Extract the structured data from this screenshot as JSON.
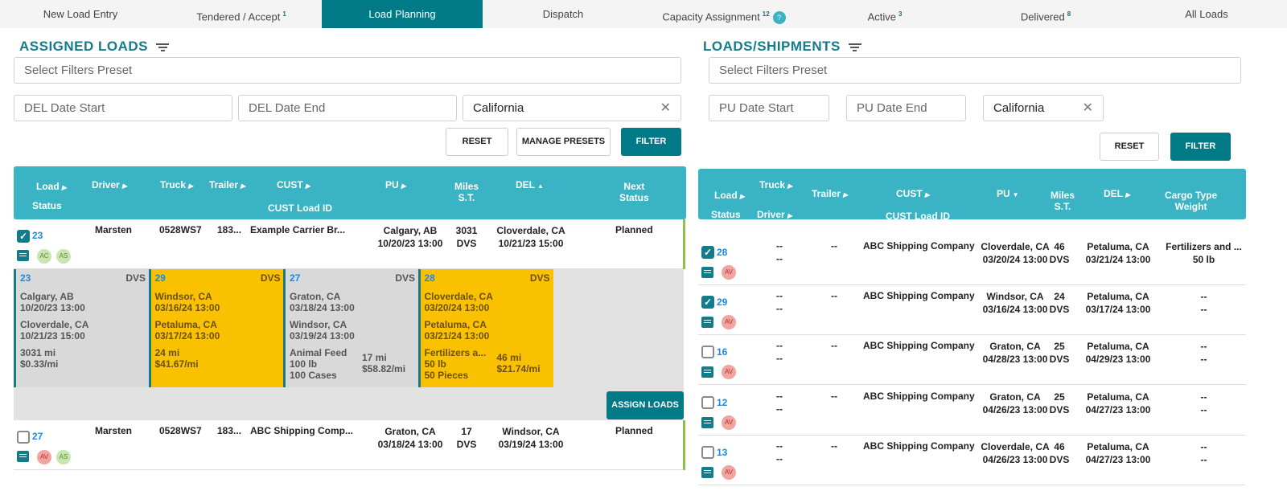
{
  "tabs": [
    {
      "label": "New Load Entry",
      "count": ""
    },
    {
      "label": "Tendered / Accept",
      "count": "1"
    },
    {
      "label": "Load Planning",
      "count": "",
      "active": true
    },
    {
      "label": "Dispatch",
      "count": ""
    },
    {
      "label": "Capacity Assignment",
      "count": "12",
      "help": "?"
    },
    {
      "label": "Active",
      "count": "3"
    },
    {
      "label": "Delivered",
      "count": "8"
    },
    {
      "label": "All Loads",
      "count": ""
    }
  ],
  "left": {
    "title": "ASSIGNED LOADS",
    "preset_placeholder": "Select Filters Preset",
    "date_start": "DEL Date Start",
    "date_end": "DEL Date End",
    "state": "California",
    "reset": "RESET",
    "manage": "MANAGE PRESETS",
    "filter": "FILTER",
    "assign": "ASSIGN LOADS",
    "headers": {
      "load": "Load",
      "status": "Status",
      "driver": "Driver",
      "truck": "Truck",
      "trailer": "Trailer",
      "cust": "CUST",
      "cust_id": "CUST Load ID",
      "pu": "PU",
      "miles": "Miles",
      "st": "S.T.",
      "del": "DEL",
      "next1": "Next",
      "next2": "Status"
    },
    "rows": [
      {
        "id": "23",
        "checked": true,
        "driver": "Marsten",
        "truck": "0528WS7",
        "trailer": "183...",
        "cust": "Example Carrier Br...",
        "pu_city": "Calgary, AB",
        "pu_date": "10/20/23 13:00",
        "miles": "3031",
        "st": "DVS",
        "del_city": "Cloverdale, CA",
        "del_date": "10/21/23 15:00",
        "next": "Planned",
        "badges": [
          "AC",
          "AS"
        ]
      },
      {
        "id": "27",
        "checked": false,
        "driver": "Marsten",
        "truck": "0528WS7",
        "trailer": "183...",
        "cust": "ABC Shipping Comp...",
        "pu_city": "Graton, CA",
        "pu_date": "03/18/24 13:00",
        "miles": "17",
        "st": "DVS",
        "del_city": "Windsor, CA",
        "del_date": "03/19/24 13:00",
        "next": "Planned",
        "badges": [
          "AV",
          "AS"
        ]
      }
    ],
    "cards": [
      {
        "id": "23",
        "st": "DVS",
        "pu_city": "Calgary, AB",
        "pu_date": "10/20/23 13:00",
        "del_city": "Cloverdale, CA",
        "del_date": "10/21/23 15:00",
        "cargo": [],
        "miles": "3031 mi",
        "rate": "$0.33/mi",
        "highlight": false
      },
      {
        "id": "29",
        "st": "DVS",
        "pu_city": "Windsor, CA",
        "pu_date": "03/16/24 13:00",
        "del_city": "Petaluma, CA",
        "del_date": "03/17/24 13:00",
        "cargo": [],
        "miles": "24 mi",
        "rate": "$41.67/mi",
        "highlight": true
      },
      {
        "id": "27",
        "st": "DVS",
        "pu_city": "Graton, CA",
        "pu_date": "03/18/24 13:00",
        "del_city": "Windsor, CA",
        "del_date": "03/19/24 13:00",
        "cargo": [
          "Animal Feed",
          "100 lb",
          "100 Cases"
        ],
        "miles": "17 mi",
        "rate": "$58.82/mi",
        "highlight": false
      },
      {
        "id": "28",
        "st": "DVS",
        "pu_city": "Cloverdale, CA",
        "pu_date": "03/20/24 13:00",
        "del_city": "Petaluma, CA",
        "del_date": "03/21/24 13:00",
        "cargo": [
          "Fertilizers a...",
          "50 lb",
          "50 Pieces"
        ],
        "miles": "46 mi",
        "rate": "$21.74/mi",
        "highlight": true
      }
    ]
  },
  "right": {
    "title": "LOADS/SHIPMENTS",
    "preset_placeholder": "Select Filters Preset",
    "date_start": "PU Date Start",
    "date_end": "PU Date End",
    "state": "California",
    "reset": "RESET",
    "filter": "FILTER",
    "headers": {
      "load": "Load",
      "status": "Status",
      "truck": "Truck",
      "driver": "Driver",
      "trailer": "Trailer",
      "cust": "CUST",
      "cust_id": "CUST Load ID",
      "pu": "PU",
      "miles": "Miles",
      "st": "S.T.",
      "del": "DEL",
      "cargo": "Cargo Type",
      "weight": "Weight"
    },
    "rows": [
      {
        "id": "28",
        "checked": true,
        "truck": "--",
        "driver": "--",
        "trailer": "--",
        "cust": "ABC Shipping Company",
        "pu_city": "Cloverdale, CA",
        "pu_date": "03/20/24 13:00",
        "miles": "46",
        "st": "DVS",
        "del_city": "Petaluma, CA",
        "del_date": "03/21/24 13:00",
        "cargo": "Fertilizers and ...",
        "weight": "50 lb",
        "badge": "AV"
      },
      {
        "id": "29",
        "checked": true,
        "truck": "--",
        "driver": "--",
        "trailer": "--",
        "cust": "ABC Shipping Company",
        "pu_city": "Windsor, CA",
        "pu_date": "03/16/24 13:00",
        "miles": "24",
        "st": "DVS",
        "del_city": "Petaluma, CA",
        "del_date": "03/17/24 13:00",
        "cargo": "--",
        "weight": "--",
        "badge": "AV"
      },
      {
        "id": "16",
        "checked": false,
        "truck": "--",
        "driver": "--",
        "trailer": "--",
        "cust": "ABC Shipping Company",
        "pu_city": "Graton, CA",
        "pu_date": "04/28/23 13:00",
        "miles": "25",
        "st": "DVS",
        "del_city": "Petaluma, CA",
        "del_date": "04/29/23 13:00",
        "cargo": "--",
        "weight": "--",
        "badge": "AV"
      },
      {
        "id": "12",
        "checked": false,
        "truck": "--",
        "driver": "--",
        "trailer": "--",
        "cust": "ABC Shipping Company",
        "pu_city": "Graton, CA",
        "pu_date": "04/26/23 13:00",
        "miles": "25",
        "st": "DVS",
        "del_city": "Petaluma, CA",
        "del_date": "04/27/23 13:00",
        "cargo": "--",
        "weight": "--",
        "badge": "AV"
      },
      {
        "id": "13",
        "checked": false,
        "truck": "--",
        "driver": "--",
        "trailer": "--",
        "cust": "ABC Shipping Company",
        "pu_city": "Cloverdale, CA",
        "pu_date": "04/26/23 13:00",
        "miles": "46",
        "st": "DVS",
        "del_city": "Petaluma, CA",
        "del_date": "04/27/23 13:00",
        "cargo": "--",
        "weight": "--",
        "badge": "AV"
      }
    ]
  }
}
